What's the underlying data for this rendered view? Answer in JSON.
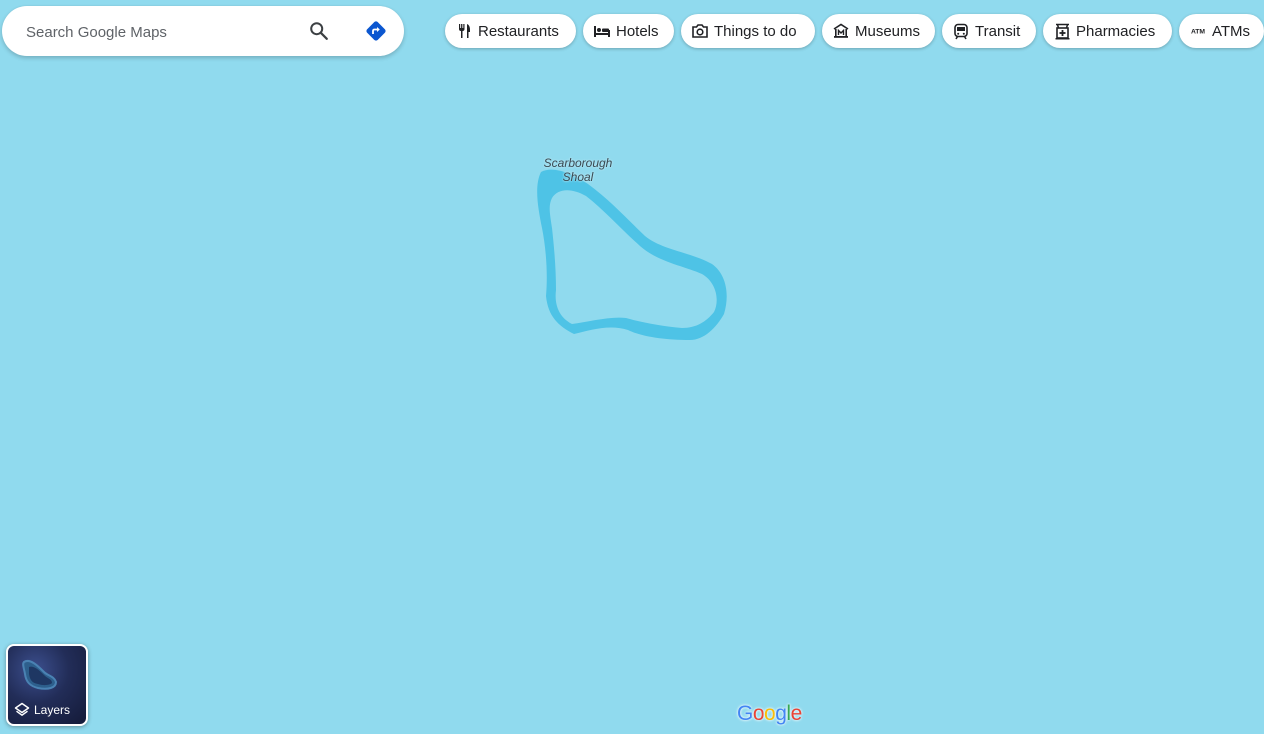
{
  "search": {
    "placeholder": "Search Google Maps",
    "search_icon": "search-icon",
    "directions_icon": "directions-icon"
  },
  "categories": [
    {
      "label": "Restaurants",
      "icon": "restaurant-icon"
    },
    {
      "label": "Hotels",
      "icon": "hotel-icon"
    },
    {
      "label": "Things to do",
      "icon": "camera-icon"
    },
    {
      "label": "Museums",
      "icon": "museum-icon"
    },
    {
      "label": "Transit",
      "icon": "transit-icon"
    },
    {
      "label": "Pharmacies",
      "icon": "pharmacy-icon"
    },
    {
      "label": "ATMs",
      "icon": "atm-icon"
    }
  ],
  "map": {
    "place_label_line1": "Scarborough",
    "place_label_line2": "Shoal",
    "water_color": "#90daee",
    "reef_color": "#4ec3e6"
  },
  "layers": {
    "label": "Layers"
  },
  "logo": {
    "letters": [
      "G",
      "o",
      "o",
      "g",
      "l",
      "e"
    ],
    "colors": [
      "#4285F4",
      "#EA4335",
      "#FBBC05",
      "#4285F4",
      "#34A853",
      "#EA4335"
    ]
  },
  "colors": {
    "directions_blue": "#0b57d0",
    "icon_gray": "#202124"
  }
}
